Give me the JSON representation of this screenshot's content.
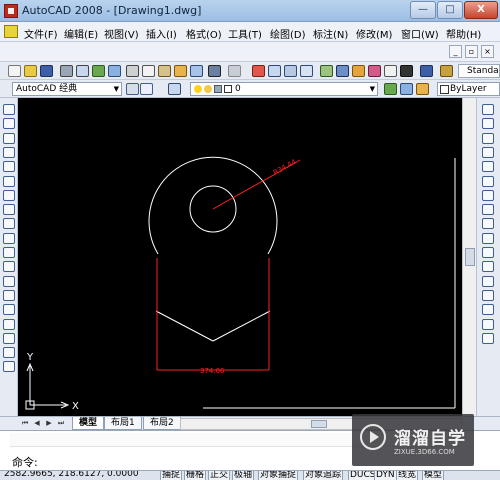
{
  "window": {
    "title": "AutoCAD 2008 - [Drawing1.dwg]",
    "buttons": {
      "minimize": "—",
      "maximize": "□",
      "close": "X"
    }
  },
  "menubar": {
    "items": [
      "文件(F)",
      "编辑(E)",
      "视图(V)",
      "插入(I)",
      "格式(O)",
      "工具(T)",
      "绘图(D)",
      "标注(N)",
      "修改(M)",
      "窗口(W)",
      "帮助(H)"
    ],
    "doc_buttons": {
      "minimize": "_",
      "restore": "▫",
      "close": "×"
    }
  },
  "toolbar": {
    "text_style": "Standard",
    "workspace": "AutoCAD 经典",
    "layer": "0",
    "color": "ByLayer"
  },
  "drawing": {
    "radius_dimension": "R34.44",
    "linear_dimension": "374.06",
    "ucs_x": "X",
    "ucs_y": "Y",
    "colors": {
      "geometry": "#ffffff",
      "dimension": "#ff2020",
      "background": "#000000"
    }
  },
  "layout_tabs": [
    "模型",
    "布局1",
    "布局2"
  ],
  "command": {
    "prompt": "命令:"
  },
  "status": {
    "coordinates": "2582.9665, 218.6127, 0.0000",
    "buttons": [
      "捕捉",
      "栅格",
      "正交",
      "极轴",
      "对象捕捉",
      "对象追踪",
      "DUCS",
      "DYN",
      "线宽",
      "模型"
    ]
  },
  "watermark": {
    "title": "溜溜自学",
    "subtitle": "ZIXUE.3D66.COM"
  }
}
